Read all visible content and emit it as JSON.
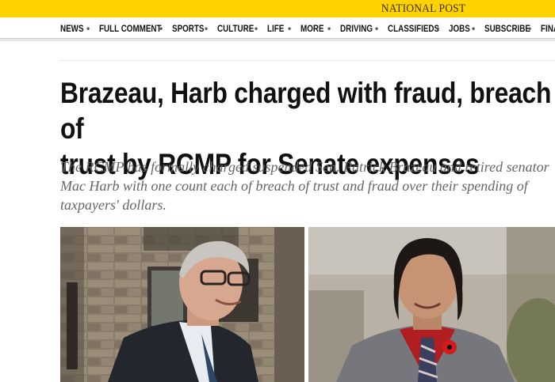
{
  "site": {
    "brand": "NATIONAL POST"
  },
  "nav": {
    "items": [
      "NEWS",
      "FULL COMMENT",
      "SPORTS",
      "CULTURE",
      "LIFE",
      "MORE",
      "DRIVING",
      "CLASSIFIEDS",
      "JOBS",
      "SUBSCRIBE",
      "FINA"
    ]
  },
  "article": {
    "headline_line1": "Brazeau, Harb charged with fraud, breach of",
    "headline_line2": "trust by RCMP for Senate expenses",
    "dek": "The RCMP has formally charged suspended Sen. Patrick Brazeau and retired senator Mac Harb with one count each of breach of trust and fraud over their spending of taxpayers' dollars."
  },
  "photos": {
    "left": {
      "subject": "man with glasses in suit in front of stone building"
    },
    "right": {
      "subject": "man with long hair in grey suit, red shirt and poppy"
    }
  },
  "colors": {
    "brand_bar": "#ffd200",
    "headline": "#111111",
    "dek": "#666666"
  }
}
